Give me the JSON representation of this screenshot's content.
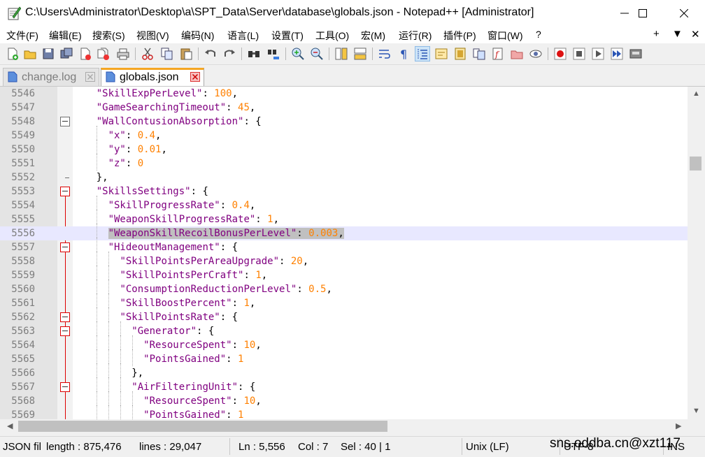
{
  "window": {
    "title": "C:\\Users\\Administrator\\Desktop\\a\\SPT_Data\\Server\\database\\globals.json - Notepad++ [Administrator]",
    "minimize_icon": "minimize-icon",
    "maximize_icon": "maximize-icon",
    "close_icon": "close-icon"
  },
  "menu": {
    "items": [
      "文件(F)",
      "编辑(E)",
      "搜索(S)",
      "视图(V)",
      "编码(N)",
      "语言(L)",
      "设置(T)",
      "工具(O)",
      "宏(M)",
      "运行(R)",
      "插件(P)",
      "窗口(W)",
      "?"
    ],
    "right_items": [
      "+",
      "▼",
      "✕"
    ]
  },
  "tabs": [
    {
      "label": "change.log",
      "active": false
    },
    {
      "label": "globals.json",
      "active": true
    }
  ],
  "editor": {
    "lines": [
      {
        "num": "5546",
        "depth": 2,
        "key": "\"SkillExpPerLevel\"",
        "sep": ": ",
        "value": "100",
        "trail": ","
      },
      {
        "num": "5547",
        "depth": 2,
        "key": "\"GameSearchingTimeout\"",
        "sep": ": ",
        "value": "45",
        "trail": ","
      },
      {
        "num": "5548",
        "depth": 2,
        "key": "\"WallContusionAbsorption\"",
        "sep": ": ",
        "value": "",
        "trail": "{"
      },
      {
        "num": "5549",
        "depth": 3,
        "key": "\"x\"",
        "sep": ": ",
        "value": "0.4",
        "trail": ","
      },
      {
        "num": "5550",
        "depth": 3,
        "key": "\"y\"",
        "sep": ": ",
        "value": "0.01",
        "trail": ","
      },
      {
        "num": "5551",
        "depth": 3,
        "key": "\"z\"",
        "sep": ": ",
        "value": "0",
        "trail": ""
      },
      {
        "num": "5552",
        "depth": 2,
        "key": "",
        "sep": "",
        "value": "",
        "trail": "},"
      },
      {
        "num": "5553",
        "depth": 2,
        "key": "\"SkillsSettings\"",
        "sep": ": ",
        "value": "",
        "trail": "{"
      },
      {
        "num": "5554",
        "depth": 3,
        "key": "\"SkillProgressRate\"",
        "sep": ": ",
        "value": "0.4",
        "trail": ","
      },
      {
        "num": "5555",
        "depth": 3,
        "key": "\"WeaponSkillProgressRate\"",
        "sep": ": ",
        "value": "1",
        "trail": ","
      },
      {
        "num": "5556",
        "depth": 3,
        "key": "\"WeaponSkillRecoilBonusPerLevel\"",
        "sep": ": ",
        "value": "0.003",
        "trail": ",",
        "selected": true
      },
      {
        "num": "5557",
        "depth": 3,
        "key": "\"HideoutManagement\"",
        "sep": ": ",
        "value": "",
        "trail": "{"
      },
      {
        "num": "5558",
        "depth": 4,
        "key": "\"SkillPointsPerAreaUpgrade\"",
        "sep": ": ",
        "value": "20",
        "trail": ","
      },
      {
        "num": "5559",
        "depth": 4,
        "key": "\"SkillPointsPerCraft\"",
        "sep": ": ",
        "value": "1",
        "trail": ","
      },
      {
        "num": "5560",
        "depth": 4,
        "key": "\"ConsumptionReductionPerLevel\"",
        "sep": ": ",
        "value": "0.5",
        "trail": ","
      },
      {
        "num": "5561",
        "depth": 4,
        "key": "\"SkillBoostPercent\"",
        "sep": ": ",
        "value": "1",
        "trail": ","
      },
      {
        "num": "5562",
        "depth": 4,
        "key": "\"SkillPointsRate\"",
        "sep": ": ",
        "value": "",
        "trail": "{"
      },
      {
        "num": "5563",
        "depth": 5,
        "key": "\"Generator\"",
        "sep": ": ",
        "value": "",
        "trail": "{"
      },
      {
        "num": "5564",
        "depth": 6,
        "key": "\"ResourceSpent\"",
        "sep": ": ",
        "value": "10",
        "trail": ","
      },
      {
        "num": "5565",
        "depth": 6,
        "key": "\"PointsGained\"",
        "sep": ": ",
        "value": "1",
        "trail": ""
      },
      {
        "num": "5566",
        "depth": 5,
        "key": "",
        "sep": "",
        "value": "",
        "trail": "},"
      },
      {
        "num": "5567",
        "depth": 5,
        "key": "\"AirFilteringUnit\"",
        "sep": ": ",
        "value": "",
        "trail": "{"
      },
      {
        "num": "5568",
        "depth": 6,
        "key": "\"ResourceSpent\"",
        "sep": ": ",
        "value": "10",
        "trail": ","
      },
      {
        "num": "5569",
        "depth": 6,
        "key": "\"PointsGained\"",
        "sep": ": ",
        "value": "1",
        "trail": ""
      }
    ]
  },
  "status": {
    "filetype": "JSON fil",
    "length": "length : 875,476",
    "lines": "lines : 29,047",
    "ln": "Ln : 5,556",
    "col": "Col : 7",
    "sel": "Sel : 40 | 1",
    "eol": "Unix (LF)",
    "encoding": "UTF-8",
    "mode": "INS"
  },
  "watermark": "sns.oddba.cn@xzt117",
  "colors": {
    "key": "#800080",
    "number": "#ff8000",
    "active_tab_accent": "#f5a623",
    "fold_line": "#dd0000"
  }
}
